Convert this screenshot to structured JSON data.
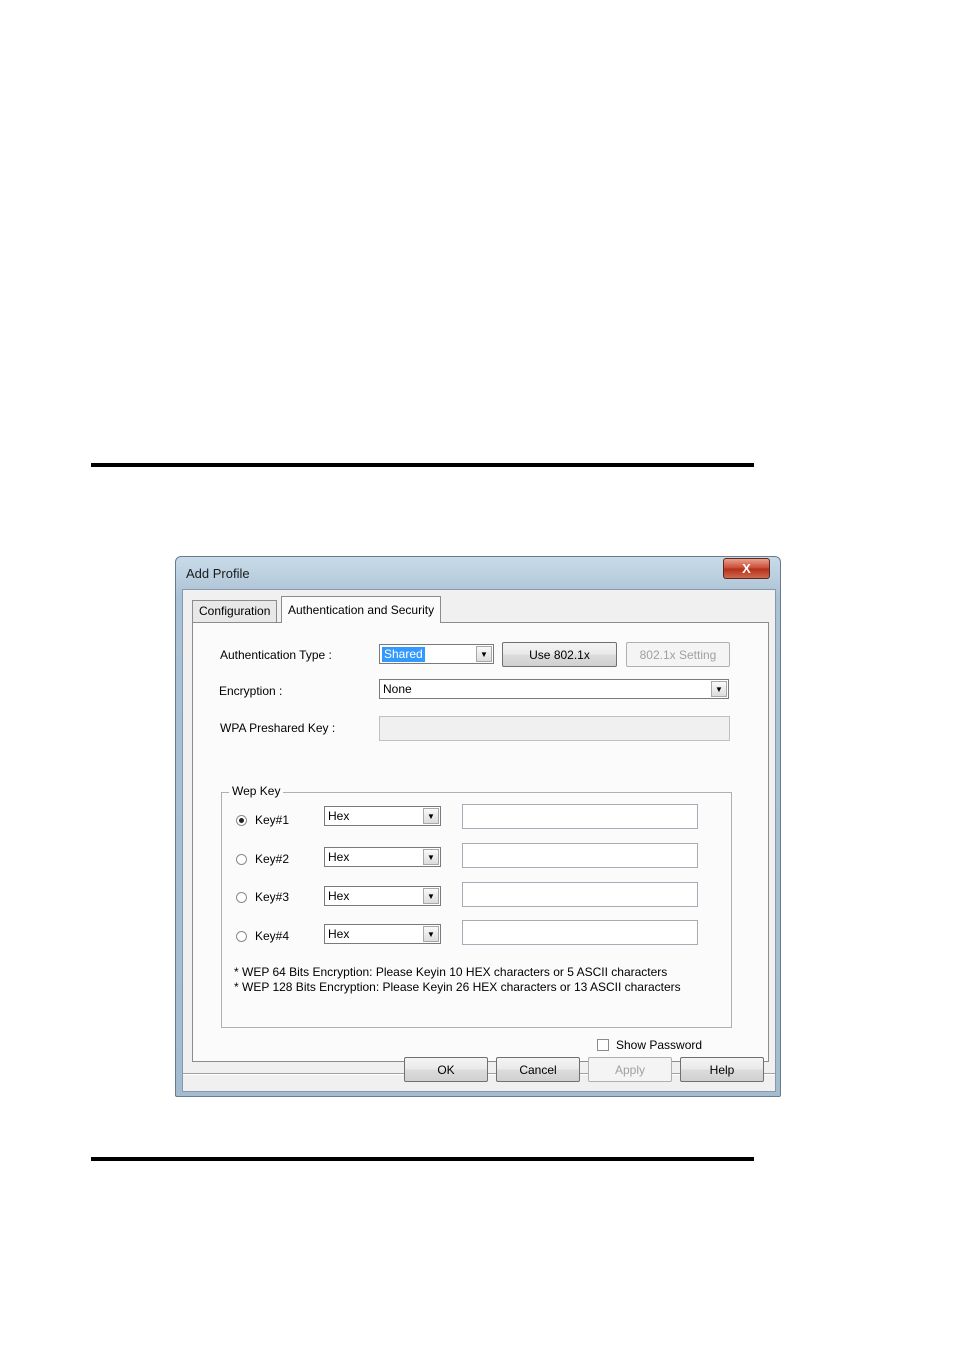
{
  "dialog": {
    "title": "Add Profile",
    "close_glyph": "X"
  },
  "tabs": [
    {
      "label": "Configuration"
    },
    {
      "label": "Authentication and Security"
    }
  ],
  "auth": {
    "auth_type_label": "Authentication Type :",
    "auth_type_value": "Shared",
    "use_8021x_label": "Use 802.1x",
    "setting_8021x_label": "802.1x Setting",
    "encryption_label": "Encryption :",
    "encryption_value": "None",
    "wpa_key_label": "WPA Preshared Key :",
    "wpa_key_value": ""
  },
  "wep": {
    "group_label": "Wep Key",
    "keys": [
      {
        "label": "Key#1",
        "format": "Hex",
        "value": "",
        "selected": true
      },
      {
        "label": "Key#2",
        "format": "Hex",
        "value": "",
        "selected": false
      },
      {
        "label": "Key#3",
        "format": "Hex",
        "value": "",
        "selected": false
      },
      {
        "label": "Key#4",
        "format": "Hex",
        "value": "",
        "selected": false
      }
    ],
    "note_64": "* WEP 64 Bits Encryption:  Please Keyin 10 HEX characters or 5 ASCII characters",
    "note_128": "* WEP 128 Bits Encryption:  Please Keyin 26 HEX characters or 13 ASCII characters"
  },
  "show_password": {
    "label": "Show Password",
    "checked": false
  },
  "footer": {
    "ok": "OK",
    "cancel": "Cancel",
    "apply": "Apply",
    "help": "Help"
  },
  "icons": {
    "dropdown": "dropdown-arrow-icon",
    "close": "close-icon"
  }
}
